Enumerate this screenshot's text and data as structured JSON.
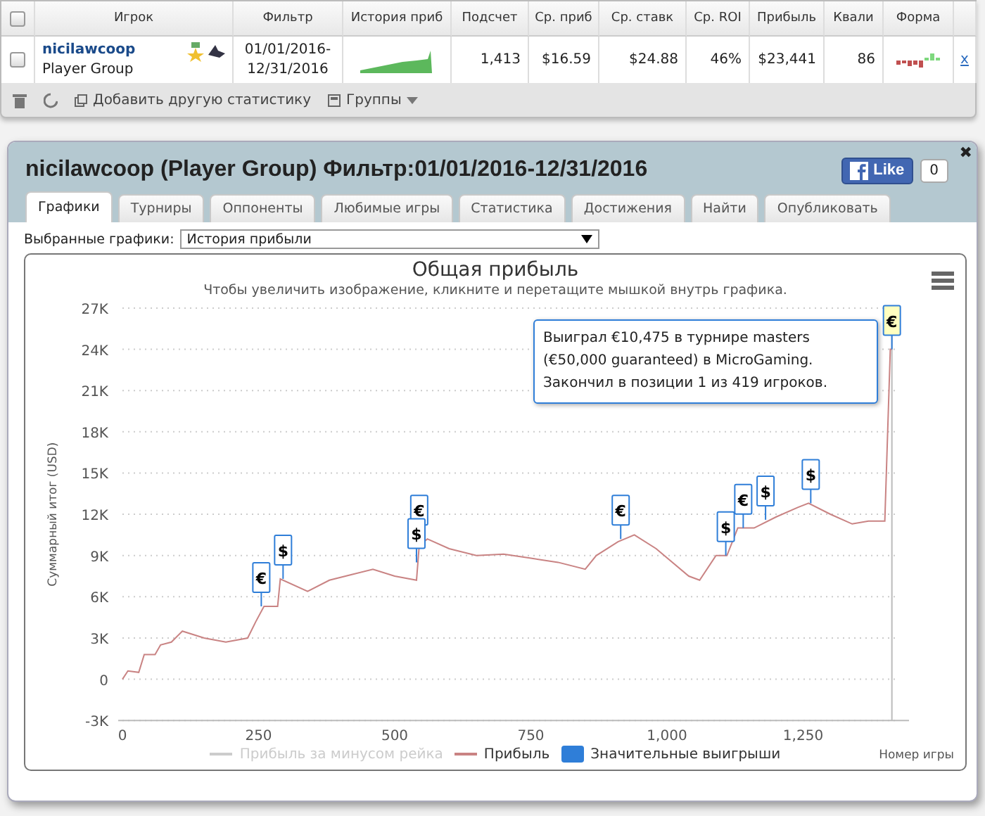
{
  "table": {
    "all_checked": false,
    "columns": [
      "Игрок",
      "Фильтр",
      "История приб",
      "Подсчет",
      "Ср. приб",
      "Ср. ставк",
      "Ср. ROI",
      "Прибыль",
      "Квали",
      "Форма"
    ],
    "rows": [
      {
        "checked": false,
        "player": "nicilawcoop",
        "group": "Player Group",
        "filter": "01/01/2016-\n12/31/2016",
        "count": "1,413",
        "avg_profit": "$16.59",
        "avg_stake": "$24.88",
        "roi": "46%",
        "profit": "$23,441",
        "qual": "86",
        "remove": "x"
      }
    ]
  },
  "toolbar": {
    "add_stat": "Добавить другую статистику",
    "groups": "Группы"
  },
  "panel": {
    "title": "nicilawcoop (Player Group) Фильтр:01/01/2016-12/31/2016",
    "like": "Like",
    "like_count": "0",
    "tabs": [
      {
        "label": "Графики",
        "selected": true
      },
      {
        "label": "Турниры",
        "selected": false
      },
      {
        "label": "Оппоненты",
        "selected": false
      },
      {
        "label": "Любимые игры",
        "selected": false
      },
      {
        "label": "Статистика",
        "selected": false
      },
      {
        "label": "Достижения",
        "selected": false
      },
      {
        "label": "Найти",
        "selected": false
      },
      {
        "label": "Опубликовать",
        "selected": false
      }
    ],
    "select_label": "Выбранные графики:",
    "select_value": "История прибыли",
    "close": "✖",
    "chart_data": {
      "type": "line",
      "grid": true,
      "title": "Общая прибыль",
      "xlabel": "Номер игры",
      "ylabel": "Суммарный итог (USD)",
      "x": [
        0,
        10,
        30,
        40,
        60,
        70,
        90,
        110,
        150,
        190,
        230,
        245,
        260,
        285,
        290,
        340,
        380,
        420,
        460,
        500,
        540,
        545,
        560,
        600,
        650,
        700,
        750,
        800,
        850,
        870,
        910,
        940,
        980,
        1040,
        1060,
        1090,
        1110,
        1130,
        1160,
        1200,
        1240,
        1260,
        1300,
        1340,
        1370,
        1400,
        1410,
        1413
      ],
      "series": [
        {
          "name": "Прибыль",
          "color": "#c98383",
          "values": [
            0,
            0.6,
            0.5,
            1.8,
            1.8,
            2.5,
            2.7,
            3.5,
            3,
            2.7,
            3,
            4.2,
            5.3,
            5.3,
            7.3,
            6.4,
            7.2,
            7.6,
            8,
            7.5,
            7.2,
            9.7,
            10.2,
            9.5,
            9,
            9.1,
            8.8,
            8.5,
            8,
            9,
            10,
            10.5,
            9.5,
            7.5,
            7.2,
            9,
            9,
            11,
            11,
            11.8,
            12.5,
            12.8,
            12,
            11.3,
            11.5,
            11.5,
            24,
            24
          ]
        }
      ],
      "xlim": [
        0,
        1413
      ],
      "ylim": [
        -3,
        27
      ],
      "xticks": [
        {
          "value": 0,
          "label": "0"
        },
        {
          "value": 250,
          "label": "250"
        },
        {
          "value": 500,
          "label": "500"
        },
        {
          "value": 750,
          "label": "750"
        },
        {
          "value": 1000,
          "label": "1,000"
        },
        {
          "value": 1250,
          "label": "1,250"
        }
      ],
      "yticks": [
        {
          "value": -3,
          "label": "-3K"
        },
        {
          "value": 0,
          "label": "0"
        },
        {
          "value": 3,
          "label": "3K"
        },
        {
          "value": 6,
          "label": "6K"
        },
        {
          "value": 9,
          "label": "9K"
        },
        {
          "value": 12,
          "label": "12K"
        },
        {
          "value": 15,
          "label": "15K"
        },
        {
          "value": 18,
          "label": "18K"
        },
        {
          "value": 21,
          "label": "21K"
        },
        {
          "value": 24,
          "label": "24K"
        },
        {
          "value": 27,
          "label": "27K"
        }
      ],
      "annotations": [
        {
          "x": 255,
          "y": 5.3,
          "text": "€"
        },
        {
          "x": 295,
          "y": 7.3,
          "text": "$"
        },
        {
          "x": 545,
          "y": 10.2,
          "text": "€"
        },
        {
          "x": 540,
          "y": 8.5,
          "text": "$"
        },
        {
          "x": 915,
          "y": 10.2,
          "text": "€"
        },
        {
          "x": 1108,
          "y": 9,
          "text": "$"
        },
        {
          "x": 1140,
          "y": 11,
          "text": "€"
        },
        {
          "x": 1181,
          "y": 11.6,
          "text": "$"
        },
        {
          "x": 1264,
          "y": 12.8,
          "text": "$"
        },
        {
          "x": 1413,
          "y": 24,
          "text": "€"
        }
      ]
    },
    "chart_subtitle": "Чтобы увеличить изображение, кликните и перетащите мышкой внутрь графика.",
    "legend": [
      {
        "kind": "hidden_series",
        "label": "Прибыль за минусом рейка"
      },
      {
        "kind": "series"
      },
      {
        "kind": "flag",
        "label": "Значительные выигрыши",
        "color": "#2f7ed8"
      }
    ],
    "tooltip": "Выиграл €10,475 в турнире masters (€50,000 guaranteed) в MicroGaming. Закончил в позиции 1 из 419 игроков."
  }
}
